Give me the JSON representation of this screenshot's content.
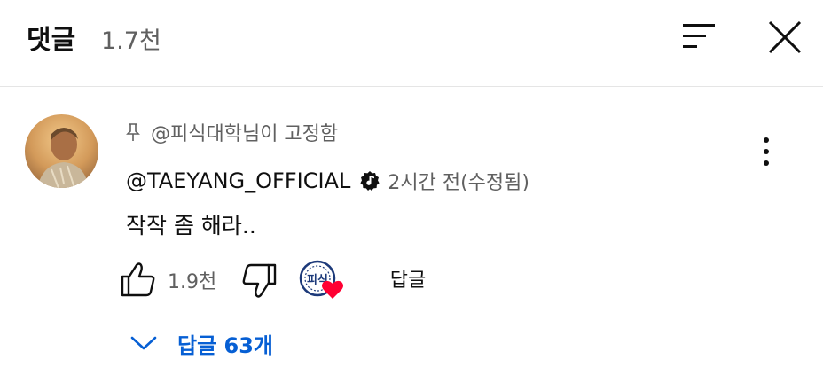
{
  "header": {
    "title": "댓글",
    "count": "1.7천"
  },
  "comment": {
    "pinned_label": "@피식대학님이 고정함",
    "author": "@TAEYANG_OFFICIAL",
    "time": "2시간 전(수정됨)",
    "text": "작작 좀 해라..",
    "like_count": "1.9천",
    "reply_label": "답글",
    "replies_label": "답글 63개",
    "creator_heart_badge_text": "피식"
  },
  "colors": {
    "link_blue": "#065fd4",
    "heart_red": "#ff0033",
    "secondary_text": "#606060"
  },
  "icons": [
    "sort-icon",
    "close-icon",
    "pin-icon",
    "verified-icon",
    "more-vert-icon",
    "thumbs-up-icon",
    "thumbs-down-icon",
    "heart-icon",
    "chevron-down-icon"
  ]
}
